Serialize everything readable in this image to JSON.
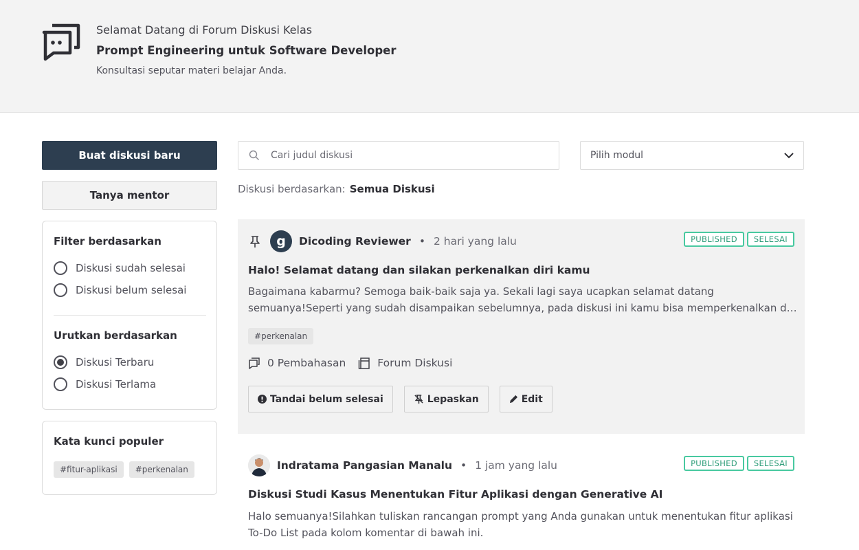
{
  "header": {
    "welcome": "Selamat Datang di Forum Diskusi Kelas",
    "course": "Prompt Engineering untuk Software Developer",
    "subtitle": "Konsultasi seputar materi belajar Anda."
  },
  "sidebar": {
    "new_discussion": "Buat diskusi baru",
    "ask_mentor": "Tanya mentor",
    "filter": {
      "title": "Filter berdasarkan",
      "options": [
        "Diskusi sudah selesai",
        "Diskusi belum selesai"
      ]
    },
    "sort": {
      "title": "Urutkan berdasarkan",
      "options": [
        "Diskusi Terbaru",
        "Diskusi Terlama"
      ],
      "selected": "Diskusi Terbaru"
    },
    "keywords": {
      "title": "Kata kunci populer",
      "tags": [
        "#fitur-aplikasi",
        "#perkenalan"
      ]
    }
  },
  "search": {
    "placeholder": "Cari judul diskusi"
  },
  "module_select": {
    "placeholder": "Pilih modul"
  },
  "filter_status": {
    "label": "Diskusi berdasarkan:",
    "value": "Semua Diskusi"
  },
  "posts": [
    {
      "author": "Dicoding Reviewer",
      "avatar_letter": "g",
      "separator": "•",
      "time": "2 hari yang lalu",
      "badges": [
        "PUBLISHED",
        "SELESAI"
      ],
      "title": "Halo! Selamat datang dan silakan perkenalkan diri kamu",
      "body_line1": "Bagaimana kabarmu? Semoga baik-baik saja ya. Sekali lagi saya ucapkan selamat datang",
      "body_line2": "semuanya!Seperti yang sudah disampaikan sebelumnya, pada diskusi ini kamu bisa memperkenalkan diri kamu...",
      "tag": "#perkenalan",
      "replies": "0 Pembahasan",
      "category": "Forum Diskusi",
      "actions": [
        "Tandai belum selesai",
        "Lepaskan",
        "Edit"
      ]
    },
    {
      "author": "Indratama Pangasian Manalu",
      "separator": "•",
      "time": "1 jam yang lalu",
      "badges": [
        "PUBLISHED",
        "SELESAI"
      ],
      "title": "Diskusi Studi Kasus Menentukan Fitur Aplikasi dengan Generative AI",
      "body_line1": "Halo semuanya!Silahkan tuliskan rancangan prompt yang Anda gunakan untuk menentukan fitur aplikasi",
      "body_line2": "To-Do List pada kolom komentar di bawah ini."
    }
  ],
  "colors": {
    "primary_button": "#2d3e50",
    "badge_border": "#48c9a0",
    "badge_text": "#2d9c78",
    "header_bg": "#f3f3f3"
  },
  "icons": [
    "chat-bubbles-logo-icon",
    "search-icon",
    "chevron-down-icon",
    "pin-icon",
    "comments-icon",
    "forum-icon",
    "exclamation-circle-icon",
    "unpin-icon",
    "pencil-icon"
  ]
}
